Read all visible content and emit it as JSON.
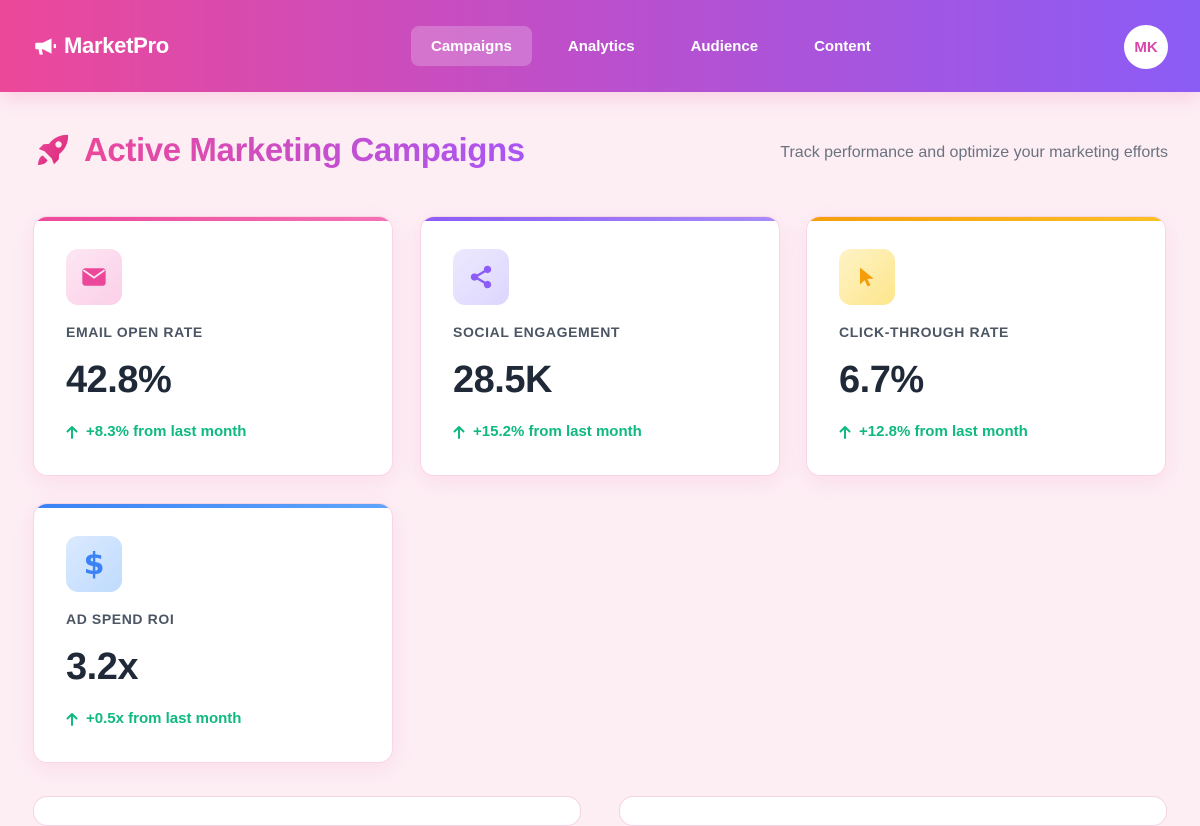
{
  "header": {
    "brand": "MarketPro",
    "brand_icon": "megaphone-icon",
    "nav": [
      {
        "label": "Campaigns",
        "active": true
      },
      {
        "label": "Analytics",
        "active": false
      },
      {
        "label": "Audience",
        "active": false
      },
      {
        "label": "Content",
        "active": false
      }
    ],
    "avatar_initials": "MK"
  },
  "page": {
    "title": "Active Marketing Campaigns",
    "title_icon": "rocket-icon",
    "subtitle": "Track performance and optimize your marketing efforts"
  },
  "metrics": [
    {
      "icon": "mail-icon",
      "label": "EMAIL OPEN RATE",
      "value": "42.8%",
      "change": "+8.3% from last month",
      "accent": "#ec4899"
    },
    {
      "icon": "share-icon",
      "label": "SOCIAL ENGAGEMENT",
      "value": "28.5K",
      "change": "+15.2% from last month",
      "accent": "#8b5cf6"
    },
    {
      "icon": "cursor-icon",
      "label": "CLICK-THROUGH RATE",
      "value": "6.7%",
      "change": "+12.8% from last month",
      "accent": "#f59e0b"
    },
    {
      "icon": "dollar-icon",
      "label": "AD SPEND ROI",
      "value": "3.2x",
      "change": "+0.5x from last month",
      "accent": "#3b82f6"
    }
  ],
  "colors": {
    "header_start": "#ec4899",
    "header_end": "#8b5cf6",
    "page_background": "#fdeef4",
    "positive_change": "#10b981"
  }
}
